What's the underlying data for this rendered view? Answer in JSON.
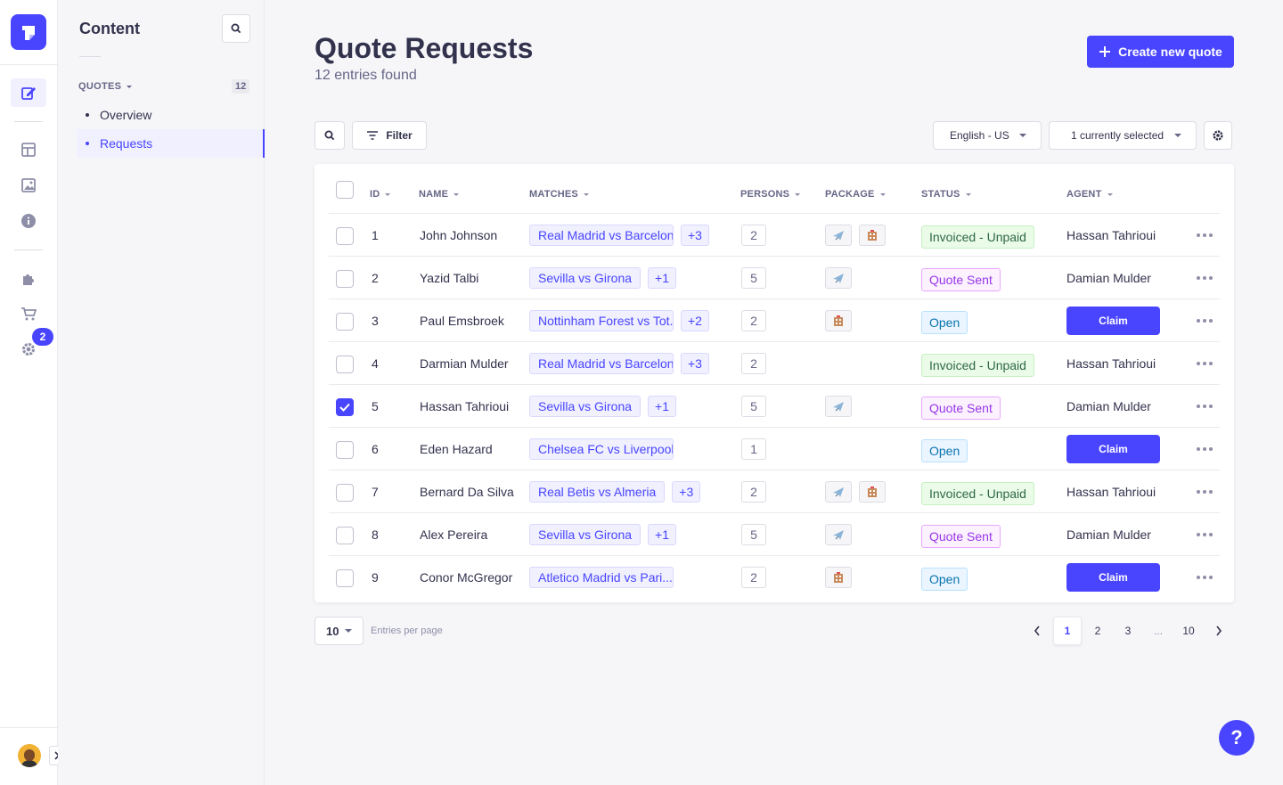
{
  "rail": {
    "icons": [
      "content-manager-icon",
      "layout-icon",
      "media-library-icon",
      "info-icon",
      "plugins-icon",
      "marketplace-icon",
      "settings-icon"
    ],
    "settings_badge": "2"
  },
  "subnav": {
    "title": "Content",
    "section_label": "QUOTES",
    "section_count": "12",
    "items": [
      {
        "label": "Overview"
      },
      {
        "label": "Requests"
      }
    ]
  },
  "header": {
    "title": "Quote Requests",
    "subtitle": "12 entries found",
    "create_label": "Create new quote"
  },
  "toolbar": {
    "filter_label": "Filter",
    "locale": "English - US",
    "selection": "1 currently selected"
  },
  "table": {
    "headers": {
      "id": "ID",
      "name": "NAME",
      "matches": "MATCHES",
      "persons": "PERSONS",
      "package": "PACKAGE",
      "status": "STATUS",
      "agent": "AGENT"
    },
    "claim_label": "Claim",
    "rows": [
      {
        "id": "1",
        "name": "John Johnson",
        "match": "Real Madrid vs Barcelona",
        "more": "+3",
        "persons": "2",
        "flight": true,
        "hotel": true,
        "status": "Invoiced - Unpaid",
        "agent": "Hassan Tahrioui",
        "checked": false
      },
      {
        "id": "2",
        "name": "Yazid Talbi",
        "match": "Sevilla vs Girona",
        "more": "+1",
        "persons": "5",
        "flight": true,
        "hotel": false,
        "status": "Quote Sent",
        "agent": "Damian Mulder",
        "checked": false
      },
      {
        "id": "3",
        "name": "Paul Emsbroek",
        "match": "Nottinham Forest vs Tot...",
        "more": "+2",
        "persons": "2",
        "flight": false,
        "hotel": true,
        "status": "Open",
        "agent": "",
        "checked": false
      },
      {
        "id": "4",
        "name": "Darmian Mulder",
        "match": "Real Madrid vs Barcelona",
        "more": "+3",
        "persons": "2",
        "flight": false,
        "hotel": false,
        "status": "Invoiced - Unpaid",
        "agent": "Hassan Tahrioui",
        "checked": false
      },
      {
        "id": "5",
        "name": "Hassan Tahrioui",
        "match": "Sevilla vs Girona",
        "more": "+1",
        "persons": "5",
        "flight": true,
        "hotel": false,
        "status": "Quote Sent",
        "agent": "Damian Mulder",
        "checked": true
      },
      {
        "id": "6",
        "name": "Eden Hazard",
        "match": "Chelsea FC vs Liverpool",
        "more": "",
        "persons": "1",
        "flight": false,
        "hotel": false,
        "status": "Open",
        "agent": "",
        "checked": false
      },
      {
        "id": "7",
        "name": "Bernard Da Silva",
        "match": "Real Betis vs Almeria",
        "more": "+3",
        "persons": "2",
        "flight": true,
        "hotel": true,
        "status": "Invoiced - Unpaid",
        "agent": "Hassan Tahrioui",
        "checked": false
      },
      {
        "id": "8",
        "name": "Alex Pereira",
        "match": "Sevilla vs Girona",
        "more": "+1",
        "persons": "5",
        "flight": true,
        "hotel": false,
        "status": "Quote Sent",
        "agent": "Damian Mulder",
        "checked": false
      },
      {
        "id": "9",
        "name": "Conor McGregor",
        "match": "Atletico Madrid vs Pari...",
        "more": "",
        "persons": "2",
        "flight": false,
        "hotel": true,
        "status": "Open",
        "agent": "",
        "checked": false
      }
    ]
  },
  "footer": {
    "per_page": "10",
    "per_page_label": "Entries per page",
    "pages": [
      "1",
      "2",
      "3",
      "...",
      "10"
    ],
    "current_page": "1"
  },
  "help_label": "?",
  "colors": {
    "accent": "#4945ff",
    "invoiced": "#2f6846",
    "quote_sent": "#9736e8",
    "open": "#0c75af"
  }
}
